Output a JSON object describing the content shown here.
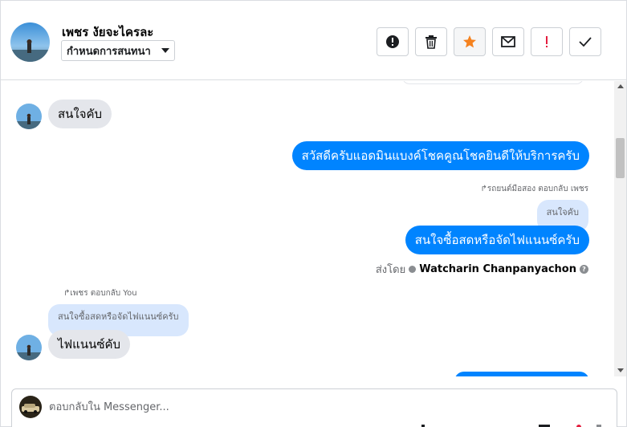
{
  "header": {
    "contact_name": "เพชร งัยจะไครละ",
    "assign_label": "กำหนดการสนทนา",
    "actions": [
      {
        "name": "mark-spam-button",
        "icon": "alert-circle-icon"
      },
      {
        "name": "delete-button",
        "icon": "trash-icon"
      },
      {
        "name": "star-button",
        "icon": "star-icon"
      },
      {
        "name": "mark-unread-button",
        "icon": "envelope-icon"
      },
      {
        "name": "follow-up-button",
        "icon": "exclamation-icon"
      },
      {
        "name": "mark-done-button",
        "icon": "check-icon"
      }
    ]
  },
  "thread": {
    "msg1": "สนใจคับ",
    "msg2": "สวัสดีครับแอดมินแบงค์โชคคูณโชคยินดีให้บริการครับ",
    "reply_hint_1": "รถยนต์มือสอง ตอบกลับ เพชร",
    "quote_1": "สนใจคับ",
    "msg3": "สนใจซื้อสดหรือจัดไฟแนนซ์ครับ",
    "sent_by_label": "ส่งโดย",
    "sent_by_name": "Watcharin Chanpanyachon",
    "reply_hint_2": "เพชร ตอบกลับ You",
    "quote_2": "สนใจซื้อสดหรือจัดไฟแนนซ์ครับ",
    "msg4": "ไฟแนนซ์คับ"
  },
  "composer": {
    "placeholder": "ตอบกลับใน Messenger..."
  },
  "colors": {
    "accent": "#0084ff",
    "incoming": "#e4e6eb",
    "quote": "#d8e7fd",
    "star": "#f5821f",
    "follow_up": "#e41e3f"
  }
}
